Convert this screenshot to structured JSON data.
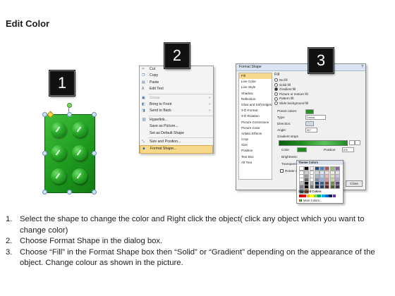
{
  "title": "Edit Color",
  "badges": [
    "1",
    "2",
    "3"
  ],
  "colors": {
    "brick_green": "#1f9a1f",
    "menu_highlight": "#f6d98a",
    "badge_bg": "#111111"
  },
  "context_menu": {
    "items": [
      {
        "icon": "cut-icon",
        "glyph": "✂",
        "label": "Cut",
        "state": "normal"
      },
      {
        "icon": "copy-icon",
        "glyph": "❐",
        "label": "Copy",
        "state": "normal"
      },
      {
        "icon": "paste-icon",
        "glyph": "▤",
        "label": "Paste",
        "state": "normal"
      },
      {
        "icon": "edit-text-icon",
        "glyph": "A",
        "label": "Edit Text",
        "state": "normal"
      },
      {
        "icon": "group-icon",
        "glyph": "▣",
        "label": "Group",
        "state": "disabled",
        "submenu": true
      },
      {
        "icon": "bring-to-front-icon",
        "glyph": "◧",
        "label": "Bring to Front",
        "state": "normal",
        "submenu": true
      },
      {
        "icon": "send-to-back-icon",
        "glyph": "◨",
        "label": "Send to Back",
        "state": "normal",
        "submenu": true
      },
      {
        "icon": "hyperlink-icon",
        "glyph": "⛓",
        "label": "Hyperlink...",
        "state": "normal"
      },
      {
        "icon": "save-as-picture-icon",
        "glyph": "",
        "label": "Save as Picture...",
        "state": "normal"
      },
      {
        "icon": "default-shape-icon",
        "glyph": "",
        "label": "Set as Default Shape",
        "state": "normal"
      },
      {
        "icon": "size-position-icon",
        "glyph": "⤡",
        "label": "Size and Position...",
        "state": "normal"
      },
      {
        "icon": "format-shape-icon",
        "glyph": "◆",
        "label": "Format Shape...",
        "state": "selected"
      }
    ]
  },
  "format_dialog": {
    "title": "Format Shape",
    "help": "?",
    "categories": [
      "Fill",
      "Line Color",
      "Line Style",
      "Shadow",
      "Reflection",
      "Glow and Soft Edges",
      "3-D Format",
      "3-D Rotation",
      "Picture Corrections",
      "Picture Color",
      "Artistic Effects",
      "Crop",
      "Size",
      "Position",
      "Text Box",
      "Alt Text"
    ],
    "fill_heading": "Fill",
    "fill_options": [
      {
        "label": "No fill",
        "selected": false
      },
      {
        "label": "Solid fill",
        "selected": false
      },
      {
        "label": "Gradient fill",
        "selected": true
      },
      {
        "label": "Picture or texture fill",
        "selected": false
      },
      {
        "label": "Pattern fill",
        "selected": false
      },
      {
        "label": "Slide background fill",
        "selected": false
      }
    ],
    "preset_label": "Preset colors:",
    "type_label": "Type:",
    "type_value": "Linear",
    "direction_label": "Direction:",
    "angle_label": "Angle:",
    "angle_value": "90°",
    "gradient_stops_label": "Gradient stops",
    "color_label": "Color",
    "position_label": "Position:",
    "position_value": "0%",
    "brightness_label": "Brightness:",
    "transparency_label": "Transparency:",
    "rotate_label": "Rotate with shape",
    "close_label": "Close"
  },
  "palette": {
    "theme_heading": "Theme Colors",
    "standard_heading": "Standard Colors",
    "more_label": "More Colors...",
    "theme_top": [
      "#ffffff",
      "#000000",
      "#eeece1",
      "#1f497d",
      "#4f81bd",
      "#c0504d",
      "#9bbb59",
      "#8064a2",
      "#4bacc6",
      "#f79646"
    ],
    "standard": [
      "#c00000",
      "#ff0000",
      "#ffc000",
      "#ffff00",
      "#92d050",
      "#00b050",
      "#00b0f0",
      "#0070c0",
      "#002060",
      "#7030a0"
    ]
  },
  "instructions": [
    {
      "num": "1.",
      "text": "Select the shape to change the color and Right click the object( click any object which you want to change color)"
    },
    {
      "num": "2.",
      "text": "Choose Format Shape in the dialog box."
    },
    {
      "num": "3.",
      "text": "Choose “Fill” in the Format Shape box then “Solid” or “Gradient” depending on the appearance of the object. Change colour as shown in the picture."
    }
  ]
}
